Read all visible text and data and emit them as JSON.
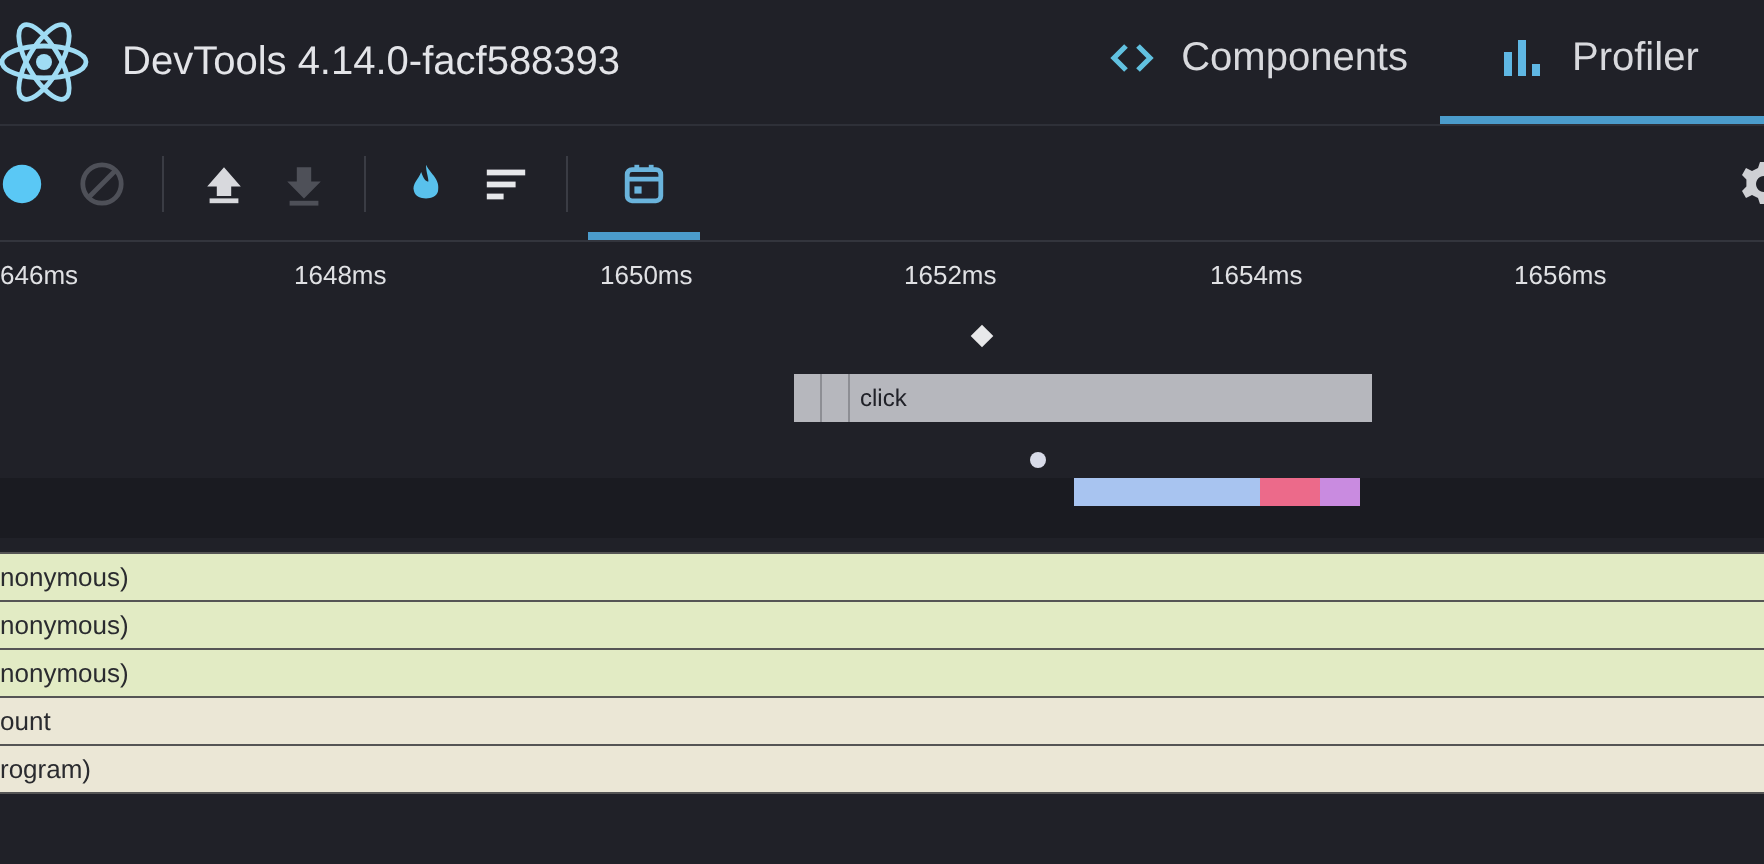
{
  "header": {
    "title": "DevTools 4.14.0-facf588393"
  },
  "tabs": [
    {
      "label": "Components",
      "selected": false,
      "kind": "code"
    },
    {
      "label": "Profiler",
      "selected": true,
      "kind": "chart"
    }
  ],
  "toolbar": [
    {
      "kind": "record",
      "disabled": false,
      "selected": false
    },
    {
      "kind": "clear",
      "disabled": true,
      "selected": false
    },
    {
      "kind": "upload",
      "disabled": false,
      "selected": false
    },
    {
      "kind": "download",
      "disabled": true,
      "selected": false
    },
    {
      "kind": "flame",
      "disabled": false,
      "selected": false
    },
    {
      "kind": "ranked",
      "disabled": false,
      "selected": false
    },
    {
      "kind": "timeline",
      "disabled": false,
      "selected": true
    }
  ],
  "time_axis": [
    "646ms",
    "1648ms",
    "1650ms",
    "1652ms",
    "1654ms",
    "1656ms"
  ],
  "event_bar": {
    "label": "click"
  },
  "flame_rows": [
    {
      "label": "nonymous)",
      "color": "#e2ebc4"
    },
    {
      "label": "nonymous)",
      "color": "#e2ebc4"
    },
    {
      "label": "nonymous)",
      "color": "#e2ebc4"
    },
    {
      "label": "ount",
      "color": "#ebe7d6"
    },
    {
      "label": "rogram)",
      "color": "#ebe7d6"
    }
  ]
}
